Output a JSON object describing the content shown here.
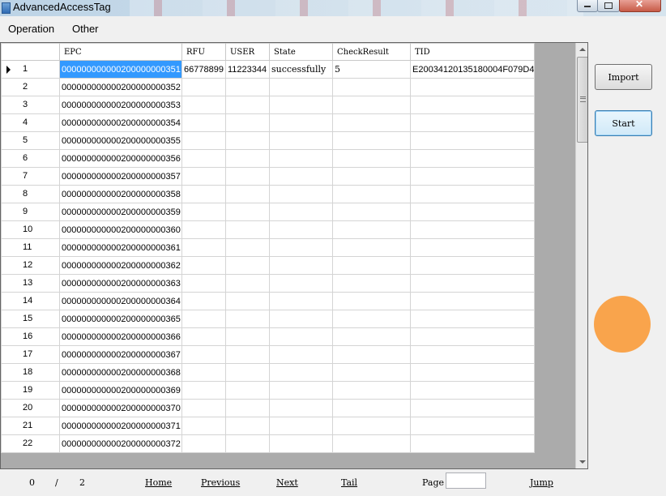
{
  "window": {
    "title": "AdvancedAccessTag"
  },
  "menu": {
    "items": [
      "Operation",
      "Other"
    ]
  },
  "grid": {
    "columns": [
      "EPC",
      "RFU",
      "USER",
      "State",
      "CheckResult",
      "TID"
    ],
    "selected_row": 1,
    "rows": [
      {
        "n": "1",
        "epc": "000000000000200000000351",
        "rfu": "66778899",
        "user": "11223344",
        "state": "successfully",
        "check": "5",
        "tid": "E2003412013518000​4F079D4"
      },
      {
        "n": "2",
        "epc": "000000000000200000000352",
        "rfu": "",
        "user": "",
        "state": "",
        "check": "",
        "tid": ""
      },
      {
        "n": "3",
        "epc": "000000000000200000000353",
        "rfu": "",
        "user": "",
        "state": "",
        "check": "",
        "tid": ""
      },
      {
        "n": "4",
        "epc": "000000000000200000000354",
        "rfu": "",
        "user": "",
        "state": "",
        "check": "",
        "tid": ""
      },
      {
        "n": "5",
        "epc": "000000000000200000000355",
        "rfu": "",
        "user": "",
        "state": "",
        "check": "",
        "tid": ""
      },
      {
        "n": "6",
        "epc": "000000000000200000000356",
        "rfu": "",
        "user": "",
        "state": "",
        "check": "",
        "tid": ""
      },
      {
        "n": "7",
        "epc": "000000000000200000000357",
        "rfu": "",
        "user": "",
        "state": "",
        "check": "",
        "tid": ""
      },
      {
        "n": "8",
        "epc": "000000000000200000000358",
        "rfu": "",
        "user": "",
        "state": "",
        "check": "",
        "tid": ""
      },
      {
        "n": "9",
        "epc": "000000000000200000000359",
        "rfu": "",
        "user": "",
        "state": "",
        "check": "",
        "tid": ""
      },
      {
        "n": "10",
        "epc": "000000000000200000000360",
        "rfu": "",
        "user": "",
        "state": "",
        "check": "",
        "tid": ""
      },
      {
        "n": "11",
        "epc": "000000000000200000000361",
        "rfu": "",
        "user": "",
        "state": "",
        "check": "",
        "tid": ""
      },
      {
        "n": "12",
        "epc": "000000000000200000000362",
        "rfu": "",
        "user": "",
        "state": "",
        "check": "",
        "tid": ""
      },
      {
        "n": "13",
        "epc": "000000000000200000000363",
        "rfu": "",
        "user": "",
        "state": "",
        "check": "",
        "tid": ""
      },
      {
        "n": "14",
        "epc": "000000000000200000000364",
        "rfu": "",
        "user": "",
        "state": "",
        "check": "",
        "tid": ""
      },
      {
        "n": "15",
        "epc": "000000000000200000000365",
        "rfu": "",
        "user": "",
        "state": "",
        "check": "",
        "tid": ""
      },
      {
        "n": "16",
        "epc": "000000000000200000000366",
        "rfu": "",
        "user": "",
        "state": "",
        "check": "",
        "tid": ""
      },
      {
        "n": "17",
        "epc": "000000000000200000000367",
        "rfu": "",
        "user": "",
        "state": "",
        "check": "",
        "tid": ""
      },
      {
        "n": "18",
        "epc": "000000000000200000000368",
        "rfu": "",
        "user": "",
        "state": "",
        "check": "",
        "tid": ""
      },
      {
        "n": "19",
        "epc": "000000000000200000000369",
        "rfu": "",
        "user": "",
        "state": "",
        "check": "",
        "tid": ""
      },
      {
        "n": "20",
        "epc": "000000000000200000000370",
        "rfu": "",
        "user": "",
        "state": "",
        "check": "",
        "tid": ""
      },
      {
        "n": "21",
        "epc": "000000000000200000000371",
        "rfu": "",
        "user": "",
        "state": "",
        "check": "",
        "tid": ""
      },
      {
        "n": "22",
        "epc": "000000000000200000000372",
        "rfu": "",
        "user": "",
        "state": "",
        "check": "",
        "tid": ""
      }
    ]
  },
  "side": {
    "import_label": "Import",
    "start_label": "Start",
    "status_color": "#f9a44c"
  },
  "pager": {
    "current": "0",
    "separator": "/",
    "total": "2",
    "home": "Home",
    "previous": "Previous",
    "next": "Next",
    "tail": "Tail",
    "page_label": "Page",
    "page_value": "",
    "jump": "Jump"
  },
  "colors": {
    "selection": "#3399ff",
    "accent": "#3c7fb1"
  }
}
